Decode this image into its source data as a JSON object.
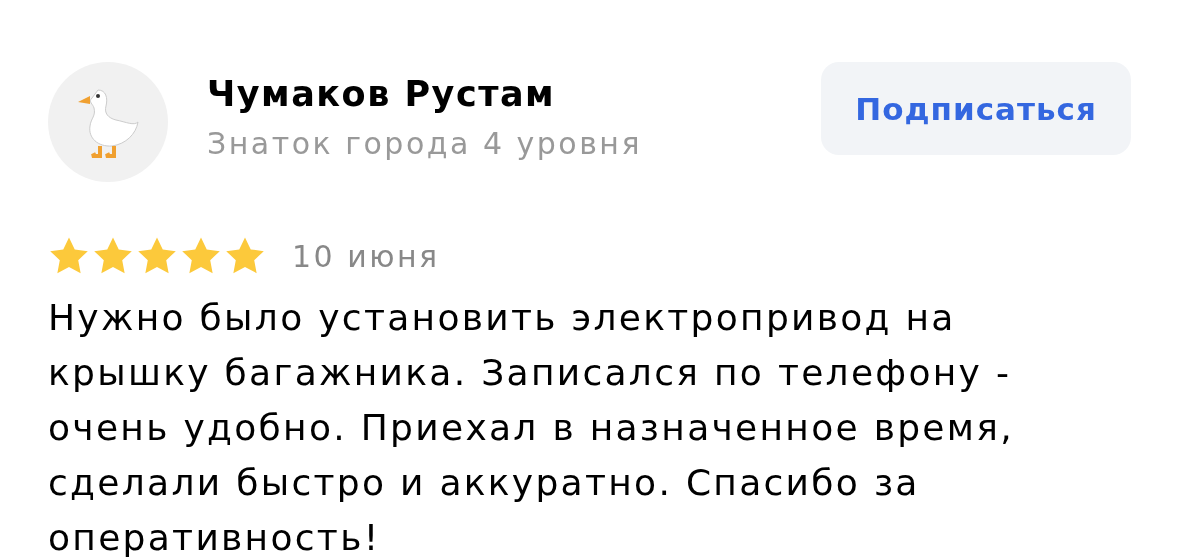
{
  "author": {
    "name": "Чумаков Рустам",
    "level": "Знаток города 4 уровня"
  },
  "subscribe_button": "Подписаться",
  "review": {
    "stars": 5,
    "date": "10 июня",
    "text": "Нужно было установить электропривод на крышку багажника. Записался по телефону - очень удобно. Приехал в назначенное время, сделали быстро и аккуратно. Спасибо за оперативность!"
  }
}
